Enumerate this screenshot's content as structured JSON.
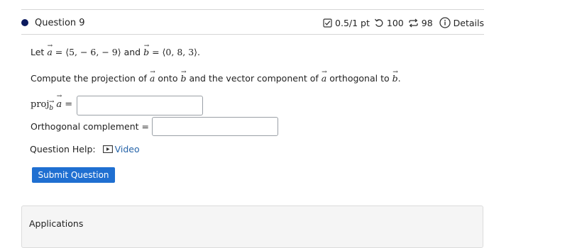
{
  "colors": {
    "bullet": "#0c1a5e",
    "accent": "#1f6fd1",
    "link": "#2563a8",
    "panel_bg": "#f5f5f5"
  },
  "question": {
    "title": "Question 9",
    "score": "0.5/1 pt",
    "attempts": "100",
    "retries": "98",
    "details_label": "Details",
    "icons": {
      "score": "checkbox-icon",
      "attempts": "undo-icon",
      "retries": "retry-icon",
      "details": "info-icon"
    }
  },
  "intro": {
    "let": "Let",
    "a_def": "⟨5, − 6, − 9⟩",
    "and": "and",
    "b_def": "⟨0, 8, 3⟩."
  },
  "task": {
    "part1": "Compute the projection of",
    "part2": "onto",
    "part3": "and the vector component of",
    "part4": "orthogonal to"
  },
  "fields": {
    "proj_label": "proj",
    "proj_value": "",
    "orth_label": "Orthogonal complement =",
    "orth_value": ""
  },
  "help": {
    "label": "Question Help:",
    "video_label": "Video"
  },
  "submit_label": "Submit Question",
  "applications_label": "Applications"
}
